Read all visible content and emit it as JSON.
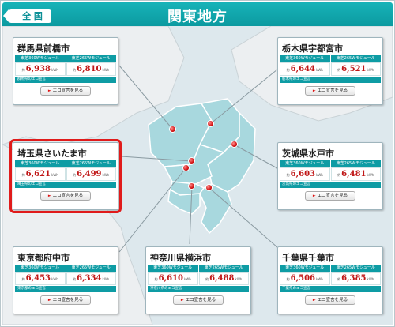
{
  "header": {
    "title": "関東地方",
    "back_label": "全 国"
  },
  "module_labels": {
    "m360": "東芝360Wモジュール",
    "m265": "東芝265Wモジュール"
  },
  "value_prefix": "約",
  "value_unit": "kWh",
  "button_label": "エコ宣言を見る",
  "cards": [
    {
      "id": "maebashi",
      "title": "群馬県前橋市",
      "v360": "6,938",
      "v265": "6,810",
      "pref": "群馬県のエコ宣言",
      "highlight": false
    },
    {
      "id": "utsunomiya",
      "title": "栃木県宇都宮市",
      "v360": "6,644",
      "v265": "6,521",
      "pref": "栃木県のエコ宣言",
      "highlight": false
    },
    {
      "id": "saitama",
      "title": "埼玉県さいたま市",
      "v360": "6,621",
      "v265": "6,499",
      "pref": "埼玉県のエコ宣言",
      "highlight": true
    },
    {
      "id": "mito",
      "title": "茨城県水戸市",
      "v360": "6,603",
      "v265": "6,481",
      "pref": "茨城県のエコ宣言",
      "highlight": false
    },
    {
      "id": "fuchu",
      "title": "東京都府中市",
      "v360": "6,453",
      "v265": "6,334",
      "pref": "東京都のエコ宣言",
      "highlight": false
    },
    {
      "id": "yokohama",
      "title": "神奈川県横浜市",
      "v360": "6,610",
      "v265": "6,488",
      "pref": "神奈川県のエコ宣言",
      "highlight": false
    },
    {
      "id": "chiba",
      "title": "千葉県千葉市",
      "v360": "6,506",
      "v265": "6,385",
      "pref": "千葉県のエコ宣言",
      "highlight": false
    }
  ],
  "colors": {
    "accent": "#0e9ca4",
    "map_land": "#a8d8de",
    "map_background": "#dde8ed",
    "highlight": "#e01b1b",
    "value": "#c01717"
  }
}
